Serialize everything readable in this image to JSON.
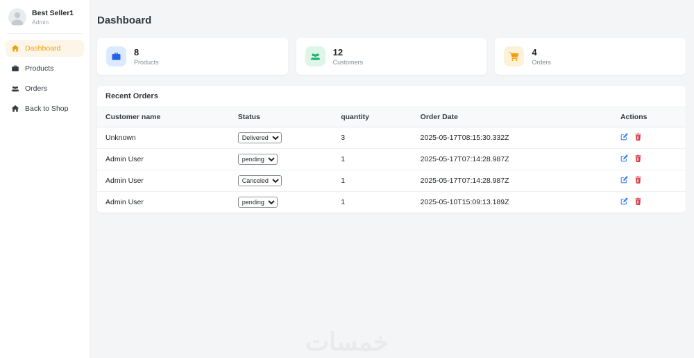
{
  "sidebar": {
    "user": {
      "name": "Best Seller1",
      "role": "Admin"
    },
    "items": [
      {
        "label": "Dashboard",
        "icon": "home-icon",
        "active": true
      },
      {
        "label": "Products",
        "icon": "briefcase-icon",
        "active": false
      },
      {
        "label": "Orders",
        "icon": "users-icon",
        "active": false
      },
      {
        "label": "Back to Shop",
        "icon": "home-icon",
        "active": false
      }
    ]
  },
  "header": {
    "title": "Dashboard"
  },
  "stats": [
    {
      "value": "8",
      "label": "Products",
      "icon": "briefcase-icon",
      "icon_color": "#2563eb",
      "icon_bg": "#dbeafe"
    },
    {
      "value": "12",
      "label": "Customers",
      "icon": "users-icon",
      "icon_color": "#22b573",
      "icon_bg": "#ddf6e8"
    },
    {
      "value": "4",
      "label": "Orders",
      "icon": "cart-icon",
      "icon_color": "#f59e0b",
      "icon_bg": "#fdf1d7"
    }
  ],
  "orders_table": {
    "title": "Recent Orders",
    "columns": [
      "Customer name",
      "Status",
      "quantity",
      "Order Date",
      "Actions"
    ],
    "rows": [
      {
        "customer": "Unknown",
        "status": "Delivered",
        "quantity": "3",
        "date": "2025-05-17T08:15:30.332Z"
      },
      {
        "customer": "Admin User",
        "status": "pending",
        "quantity": "1",
        "date": "2025-05-17T07:14:28.987Z"
      },
      {
        "customer": "Admin User",
        "status": "Canceled",
        "quantity": "1",
        "date": "2025-05-17T07:14:28.987Z"
      },
      {
        "customer": "Admin User",
        "status": "pending",
        "quantity": "1",
        "date": "2025-05-10T15:09:13.189Z"
      }
    ],
    "actions": {
      "edit": "edit-icon",
      "delete": "trash-icon"
    }
  },
  "watermark": "خمسات",
  "colors": {
    "accent_orange": "#f59e0b",
    "active_nav_bg": "#fdf6e8",
    "edit_blue": "#3b82f6",
    "delete_red": "#dc3545",
    "page_bg": "#f4f5f7",
    "card_bg": "#ffffff"
  }
}
